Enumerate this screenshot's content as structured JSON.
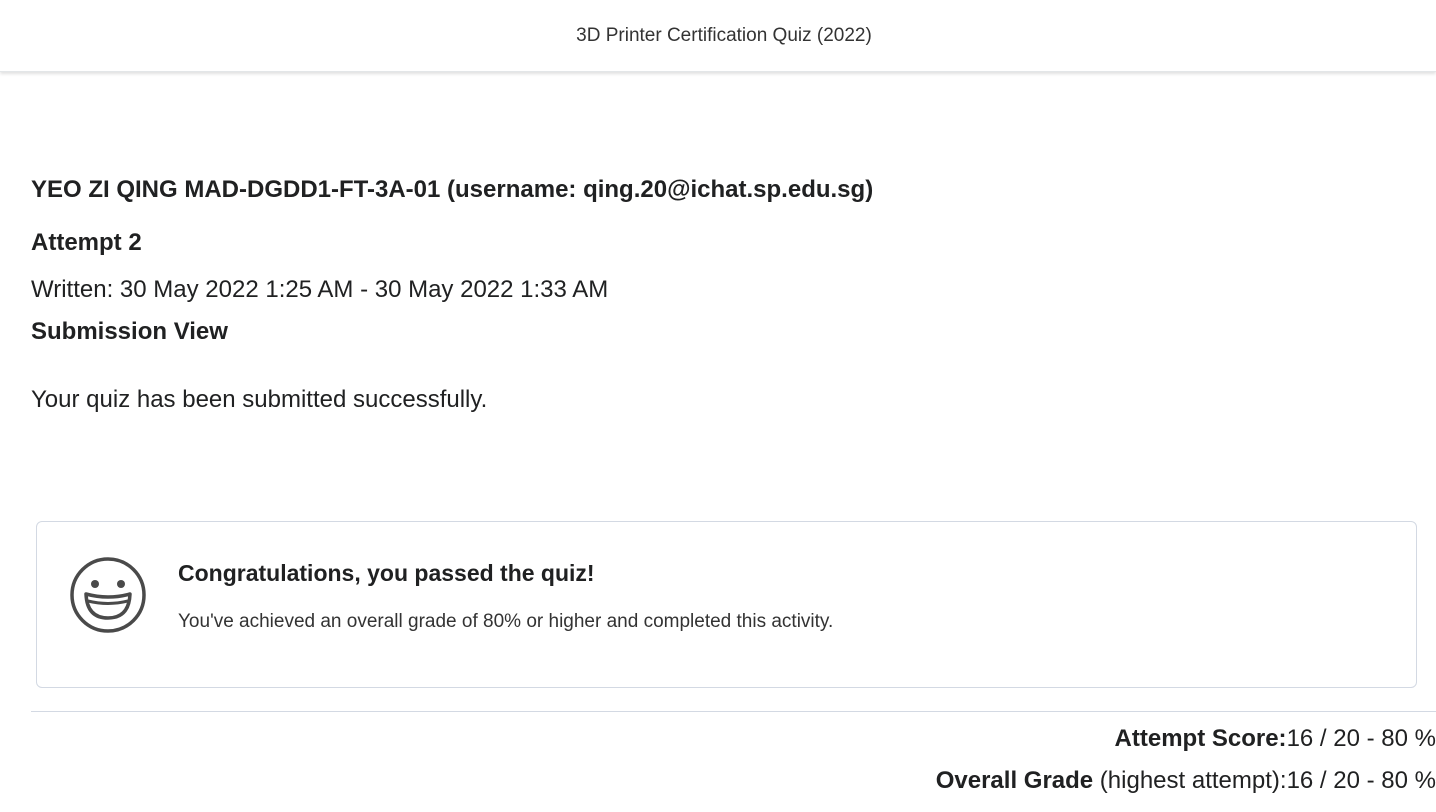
{
  "header": {
    "title": "3D Printer Certification Quiz (2022)"
  },
  "submission": {
    "user_line": "YEO ZI QING MAD-DGDD1-FT-3A-01 (username: qing.20@ichat.sp.edu.sg)",
    "attempt": "Attempt 2",
    "written": "Written: 30 May 2022 1:25 AM - 30 May 2022 1:33 AM",
    "view_heading": "Submission View",
    "status_message": "Your quiz has been submitted successfully."
  },
  "congrats": {
    "icon": "smiley-face-icon",
    "title": "Congratulations, you passed the quiz!",
    "text": "You've achieved an overall grade of 80% or higher and completed this activity."
  },
  "scores": {
    "attempt_label": "Attempt Score:",
    "attempt_value": "16 / 20 - 80 %",
    "overall_label": "Overall Grade",
    "overall_suffix": " (highest attempt):",
    "overall_value": "16 / 20 - 80 %"
  },
  "colors": {
    "text": "#202122",
    "border": "#d3d9e3"
  }
}
